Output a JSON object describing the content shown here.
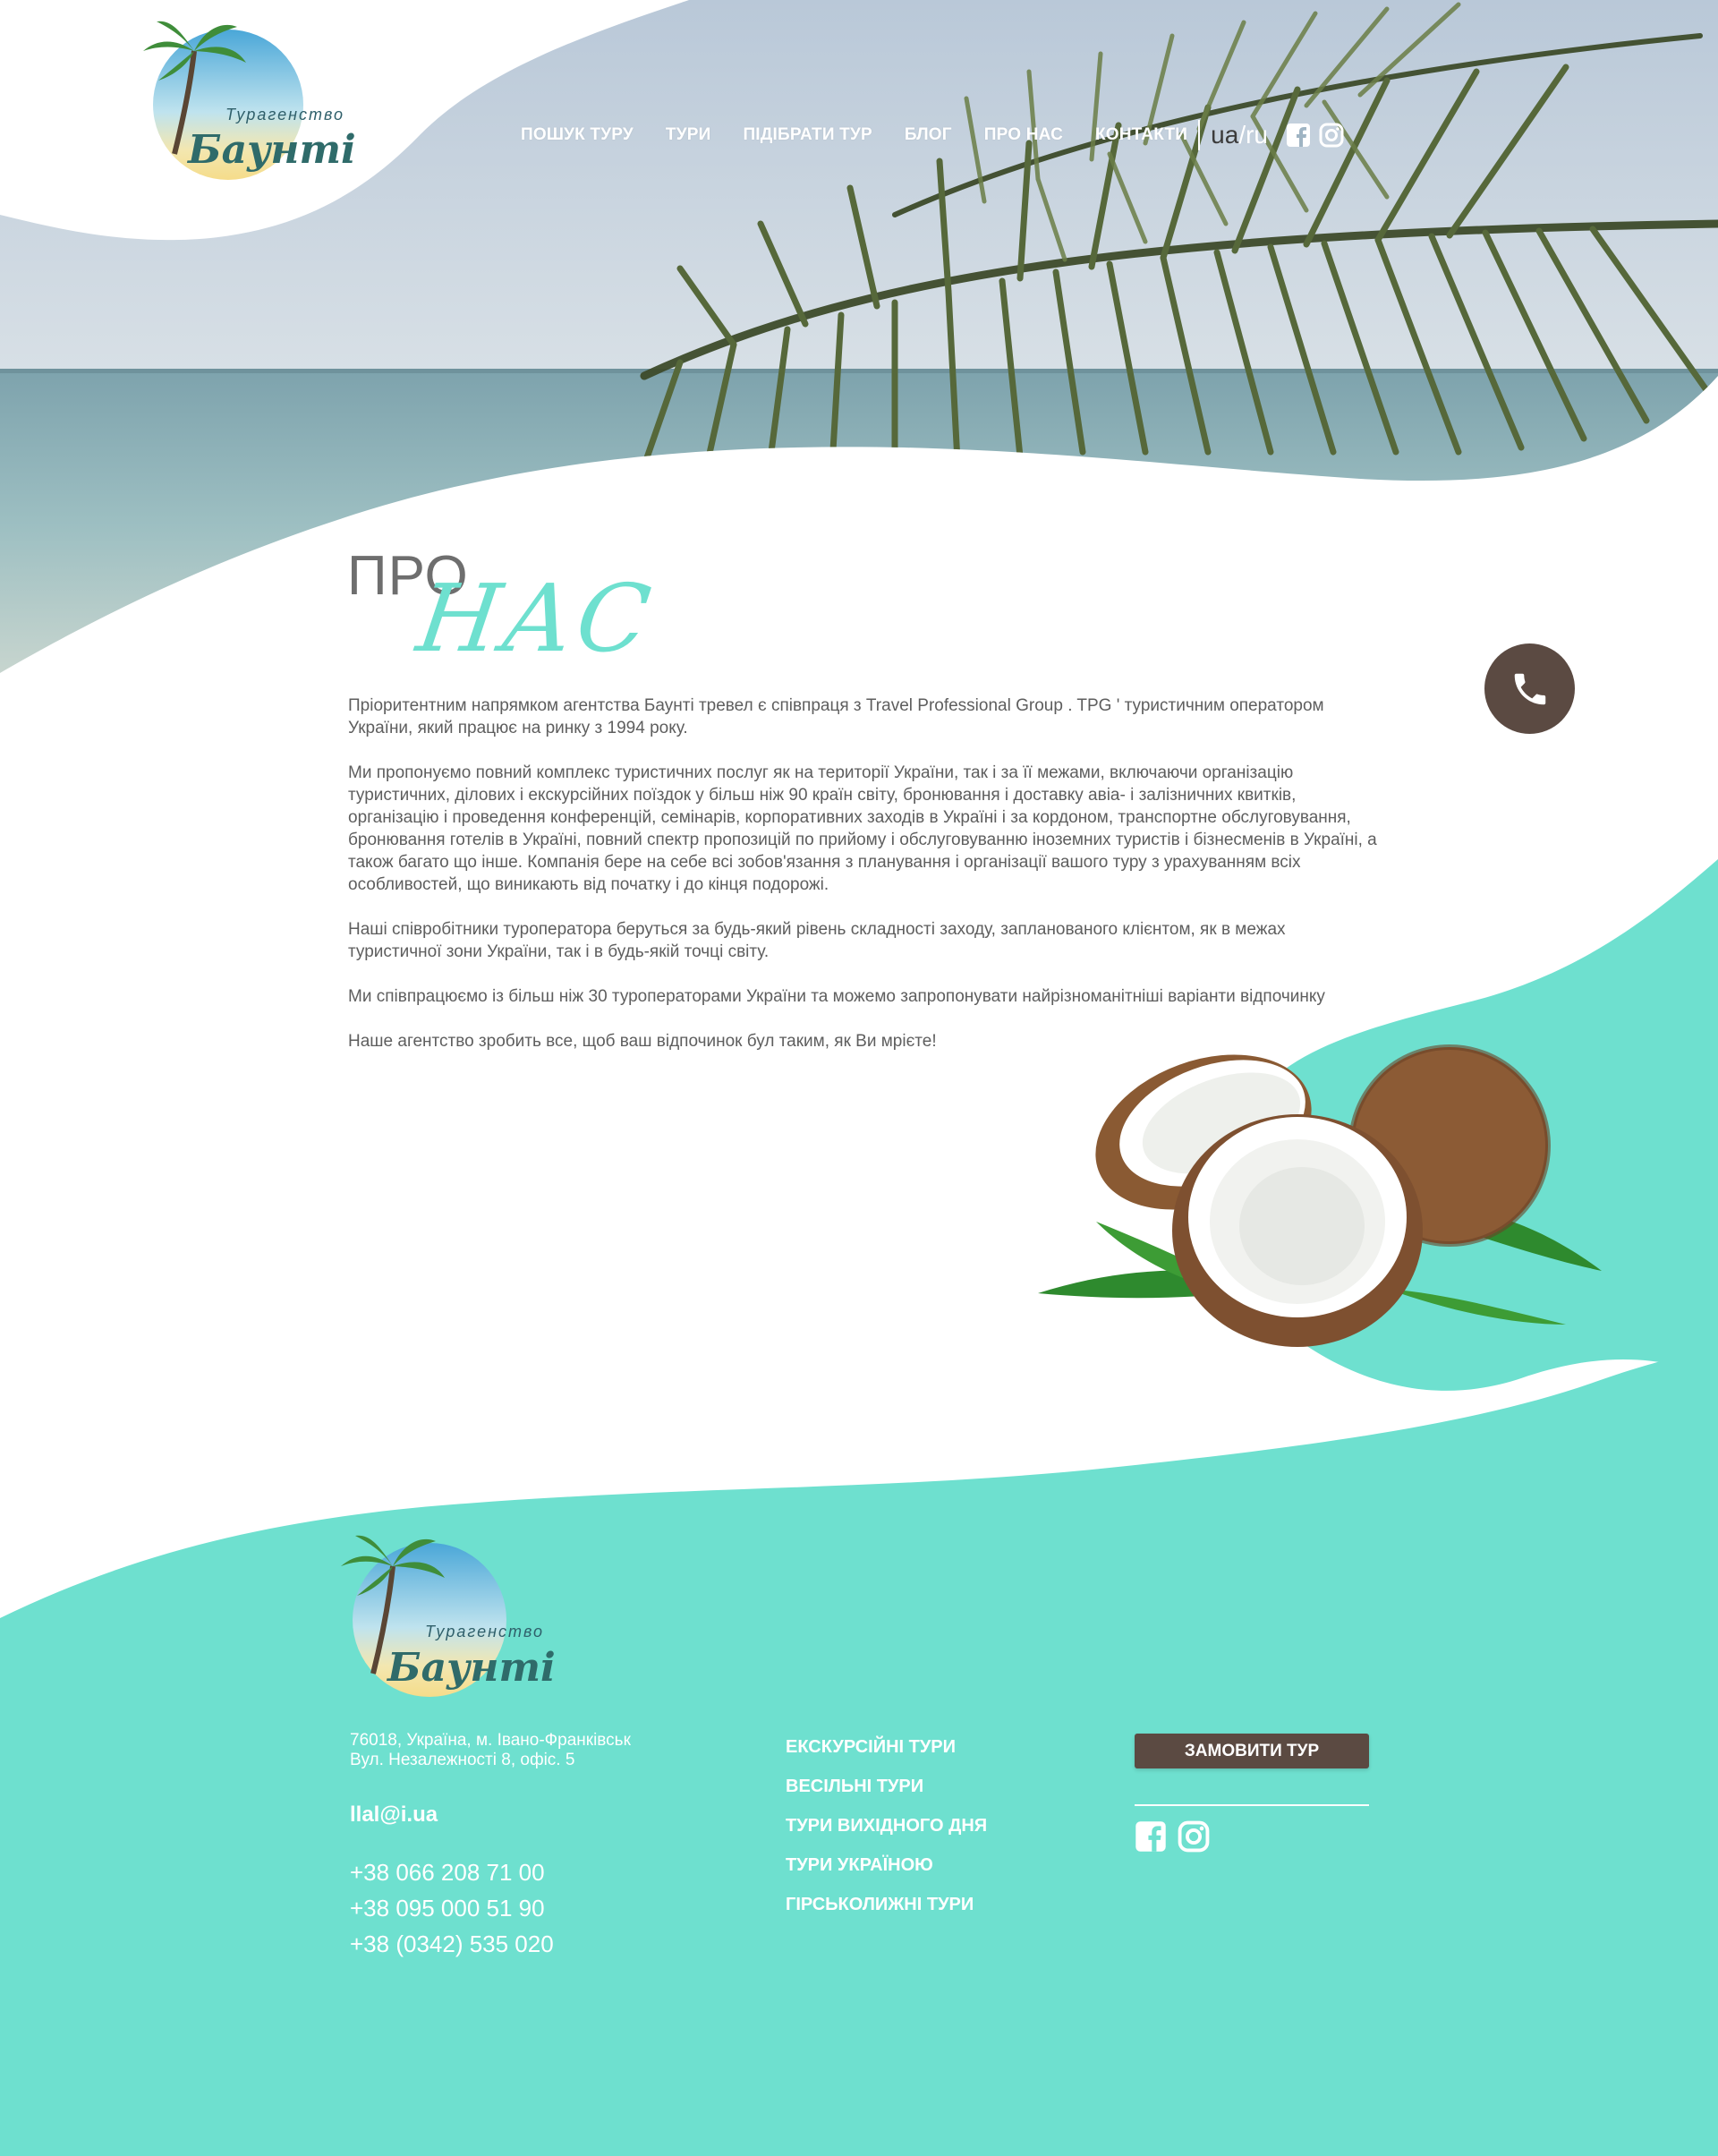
{
  "header": {
    "logo": {
      "line1": "Турагенство",
      "line2": "Баунті"
    },
    "nav": [
      {
        "label": "ПОШУК ТУРУ"
      },
      {
        "label": "ТУРИ"
      },
      {
        "label": "ПІДІБРАТИ ТУР"
      },
      {
        "label": "БЛОГ"
      },
      {
        "label": "ПРО НАС"
      },
      {
        "label": "КОНТАКТИ"
      }
    ],
    "lang": {
      "ua": "ua",
      "ru": "ru"
    },
    "icons": [
      "facebook-icon",
      "instagram-icon"
    ]
  },
  "phone_button": {
    "icon": "phone-icon"
  },
  "about": {
    "title_1": "ПРО",
    "title_2": "НАС",
    "paragraphs": [
      "Пріоритентним напрямком агентства   Баунті тревел є співпраця з  Travel Professional Group . TPG  ' туристичним оператором України, який працює на ринку з 1994 року.",
      "Ми пропонуємо повний комплекс туристичних послуг як на території України, так і за її межами, включаючи організацію туристичних, ділових і екскурсійних поїздок у більш ніж 90 країн світу, бронювання і доставку авіа- і залізничних квитків, організацію і проведення конференцій, семінарів, корпоративних заходів в Україні і за кордоном, транспортне обслуговування, бронювання готелів в Україні, повний спектр пропозицій по прийому і обслуговуванню іноземних туристів і бізнесменів в Україні, а також багато що інше. Компанія бере на себе всі зобов'язання з планування і організації вашого туру з урахуванням всіх особливостей, що виникають від початку і до кінця подорожі.",
      "Наші співробітники туроператора беруться за будь-який рівень складності заходу, запланованого клієнтом, як в межах туристичної зони України, так і в будь-якій точці світу.",
      "Ми співпрацюємо із більш ніж 30 туроператорами України та можемо запропонувати найрізноманітніші варіанти відпочинку",
      "Наше агентство зробить  все, щоб ваш відпочинок бул таким, як Ви мрієте!"
    ]
  },
  "footer": {
    "logo": {
      "line1": "Турагенство",
      "line2": "Баунті"
    },
    "address": [
      "76018, Україна, м. Івано-Франківськ",
      "Вул. Незалежності 8, офіс. 5"
    ],
    "email": "llal@i.ua",
    "phones": [
      "+38 066 208 71 00",
      "+38 095 000 51 90",
      "+38 (0342) 535 020"
    ],
    "links": [
      {
        "label": "ЕКСКУРСІЙНІ ТУРИ"
      },
      {
        "label": "ВЕСІЛЬНІ ТУРИ"
      },
      {
        "label": "ТУРИ ВИХІДНОГО ДНЯ"
      },
      {
        "label": "ТУРИ УКРАЇНОЮ"
      },
      {
        "label": "ГІРСЬКОЛИЖНІ ТУРИ"
      }
    ],
    "order_button": "ЗАМОВИТИ ТУР",
    "social": [
      "facebook-icon",
      "instagram-icon"
    ]
  },
  "colors": {
    "mint": "#6ee0cf",
    "brown": "#5b4a42",
    "text": "#5e5e5e",
    "white": "#ffffff"
  }
}
